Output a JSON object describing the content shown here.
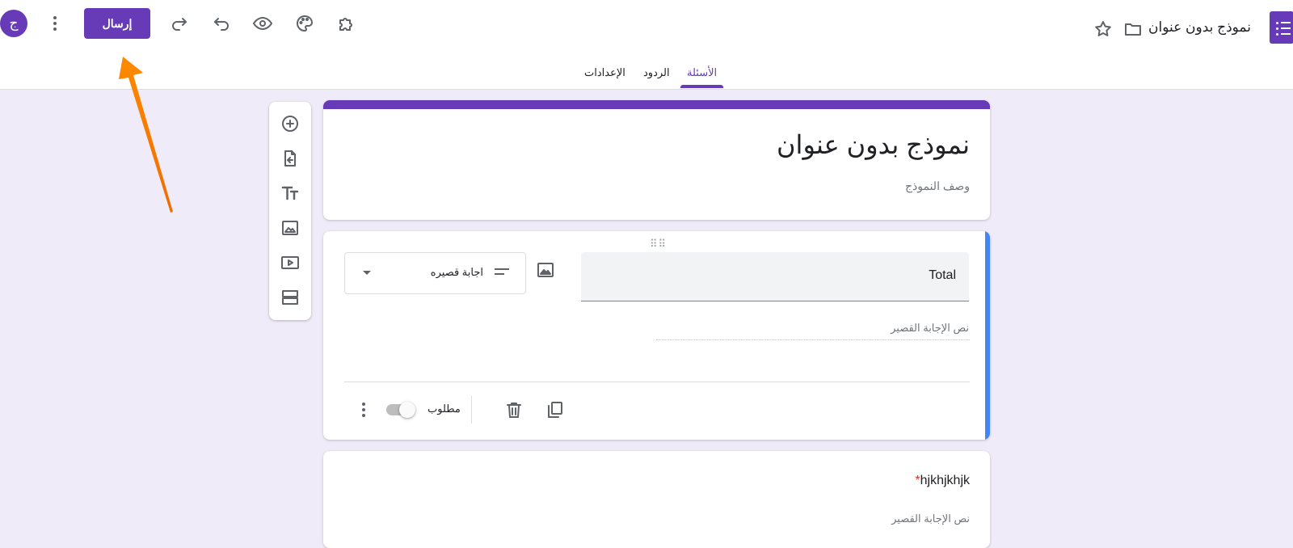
{
  "header": {
    "doc_title": "نموذج بدون عنوان",
    "send_label": "إرسال",
    "avatar_letter": "ج"
  },
  "tabs": [
    {
      "label": "الأسئلة",
      "active": true
    },
    {
      "label": "الردود",
      "active": false
    },
    {
      "label": "الإعدادات",
      "active": false
    }
  ],
  "form": {
    "title": "نموذج بدون عنوان",
    "description_placeholder": "وصف النموذج"
  },
  "question1": {
    "title": "Total",
    "type_label": "اجابة قصيره",
    "short_answer_placeholder": "نص الإجابة القصير",
    "required_label": "مطلوب",
    "required": false
  },
  "question2": {
    "title": "hjkhjkhjk",
    "required_marker": "*",
    "short_answer_placeholder": "نص الإجابة القصير"
  },
  "colors": {
    "accent": "#673ab7",
    "background": "#f0ebf8",
    "focus": "#4285f4",
    "annotation_arrow": "#f57c00"
  }
}
